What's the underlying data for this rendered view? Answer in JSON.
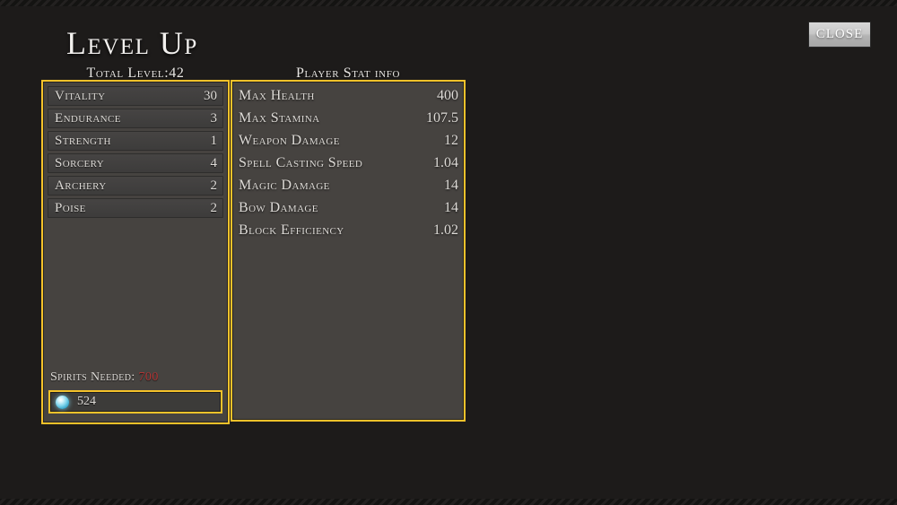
{
  "window": {
    "title": "Level Up",
    "background_color": "#1d1b1a",
    "accent_gold": "#f5c22a",
    "panel_color": "#464340"
  },
  "close_button": {
    "label": "CLOSE"
  },
  "level_panel": {
    "header": "Total Level:42",
    "attributes": [
      {
        "name": "Vitality",
        "value": "30"
      },
      {
        "name": "Endurance",
        "value": "3"
      },
      {
        "name": "Strength",
        "value": "1"
      },
      {
        "name": "Sorcery",
        "value": "4"
      },
      {
        "name": "Archery",
        "value": "2"
      },
      {
        "name": "Poise",
        "value": "2"
      }
    ],
    "spirits_needed_label": "Spirits Needed:",
    "spirits_needed_value": "700",
    "spirits_needed_color": "#b03434",
    "wallet": {
      "icon": "spirit-orb-icon",
      "amount": "524"
    }
  },
  "stat_panel": {
    "header": "Player Stat info",
    "stats": [
      {
        "name": "Max Health",
        "value": "400"
      },
      {
        "name": "Max Stamina",
        "value": "107.5"
      },
      {
        "name": "Weapon Damage",
        "value": "12"
      },
      {
        "name": "Spell Casting Speed",
        "value": "1.04"
      },
      {
        "name": "Magic Damage",
        "value": "14"
      },
      {
        "name": "Bow Damage",
        "value": "14"
      },
      {
        "name": "Block Efficiency",
        "value": "1.02"
      }
    ]
  }
}
